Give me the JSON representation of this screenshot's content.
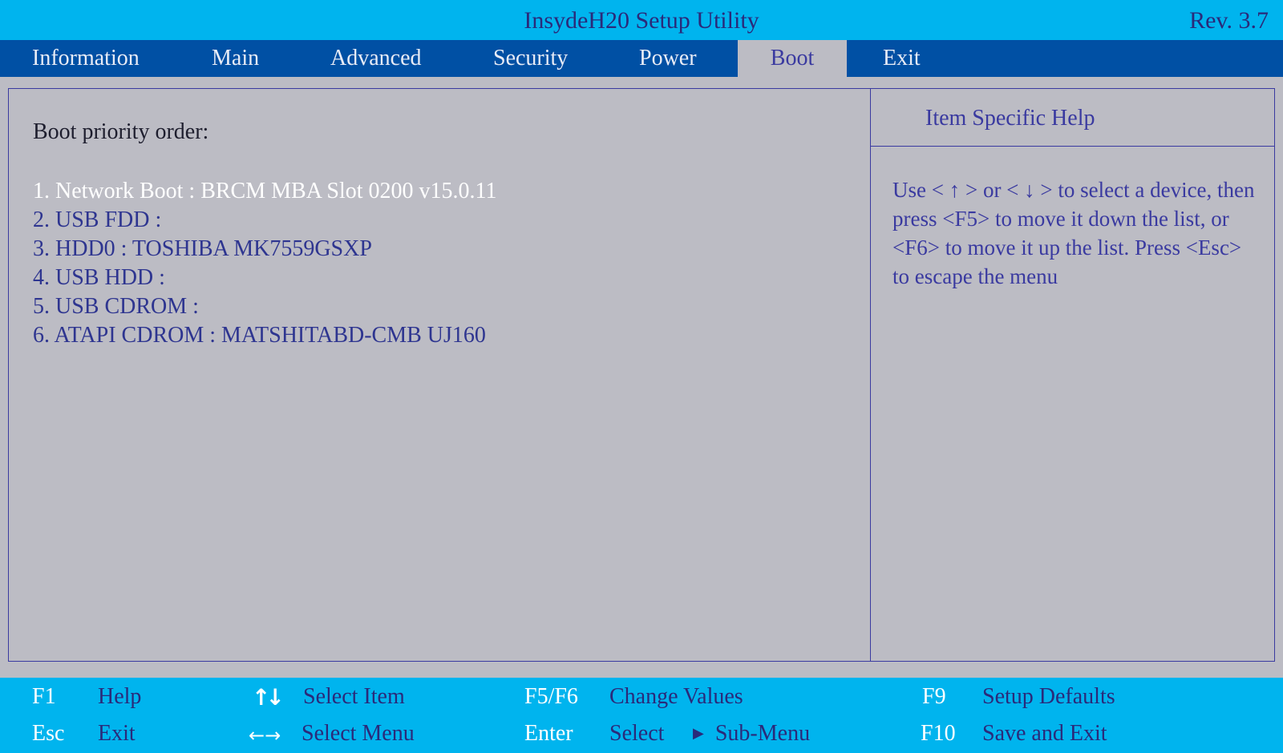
{
  "title": "InsydeH20 Setup Utility",
  "revision": "Rev. 3.7",
  "menu": [
    {
      "label": "Information"
    },
    {
      "label": "Main"
    },
    {
      "label": "Advanced"
    },
    {
      "label": "Security"
    },
    {
      "label": "Power"
    },
    {
      "label": "Boot",
      "active": true
    },
    {
      "label": "Exit"
    }
  ],
  "boot": {
    "heading": "Boot priority order:",
    "items": [
      {
        "label": "1. Network Boot : BRCM MBA Slot 0200 v15.0.11",
        "selected": true
      },
      {
        "label": "2. USB FDD :"
      },
      {
        "label": "3. HDD0 : TOSHIBA MK7559GSXP"
      },
      {
        "label": "4. USB HDD :"
      },
      {
        "label": "5. USB CDROM :"
      },
      {
        "label": "6. ATAPI CDROM : MATSHITABD-CMB UJ160"
      }
    ]
  },
  "help": {
    "title": "Item Specific Help",
    "text": "Use < ↑ > or < ↓ > to select a device, then\npress <F5> to move it down the list, or\n<F6> to move it up the list. Press <Esc>\nto escape the menu"
  },
  "footer": {
    "f1_key": "F1",
    "f1_label": "Help",
    "esc_key": "Esc",
    "esc_label": "Exit",
    "updown_icon": "up-down-arrows-icon",
    "updown_label": "Select Item",
    "leftright_icon": "left-right-arrows-icon",
    "leftright_label": "Select Menu",
    "f5f6_key": "F5/F6",
    "f5f6_label": "Change Values",
    "enter_key": "Enter",
    "enter_label": "Select",
    "submenu_icon": "triangle-right-icon",
    "submenu_label": "Sub-Menu",
    "f9_key": "F9",
    "f9_label": "Setup Defaults",
    "f10_key": "F10",
    "f10_label": "Save and Exit"
  },
  "colors": {
    "title_bar": "#00b4ee",
    "menu_bar": "#0050a4",
    "panel_bg": "#bcbcc4",
    "accent_text": "#3a3aa0",
    "selected_text": "#ffffff"
  }
}
